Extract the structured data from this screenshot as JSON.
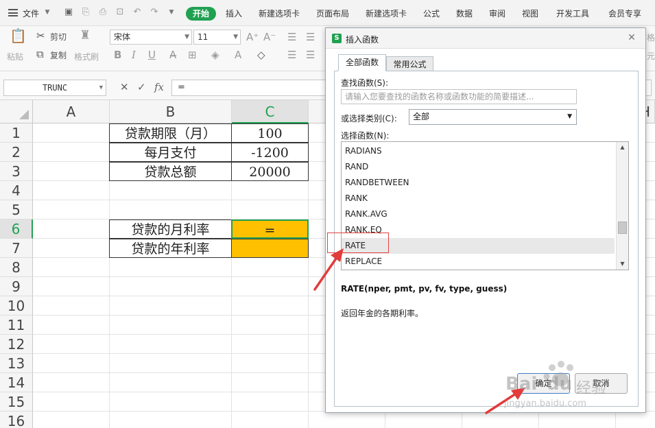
{
  "menu": {
    "file": "文件",
    "tabs": [
      "开始",
      "插入",
      "新建选项卡",
      "页面布局",
      "新建选项卡",
      "公式",
      "数据",
      "审阅",
      "视图",
      "开发工具",
      "会员专享"
    ]
  },
  "ribbon": {
    "paste": "粘贴",
    "cut": "剪切",
    "copy": "复制",
    "format_painter": "格式刷",
    "font_name": "宋体",
    "font_size": "11",
    "bold": "B",
    "italic": "I",
    "underline": "U",
    "right_fragment_1": "格",
    "right_fragment_2": "元"
  },
  "formula_bar": {
    "name_box": "TRUNC",
    "cancel_icon": "✕",
    "confirm_icon": "✓",
    "fx_label": "fx",
    "value": "="
  },
  "sheet": {
    "columns": [
      "A",
      "B",
      "C"
    ],
    "partial_column": "H",
    "rows": [
      "1",
      "2",
      "3",
      "4",
      "5",
      "6",
      "7",
      "8",
      "9",
      "10",
      "11",
      "12",
      "13",
      "14",
      "15",
      "16"
    ],
    "cells": {
      "b1": "贷款期限（月）",
      "c1": "100",
      "b2": "每月支付",
      "c2": "-1200",
      "b3": "贷款总额",
      "c3": "20000",
      "b6": "贷款的月利率",
      "c6": "=",
      "b7": "贷款的年利率",
      "c7": ""
    },
    "active_cell_color": "#ffc000"
  },
  "dialog": {
    "title": "插入函数",
    "tab_all": "全部函数",
    "tab_common": "常用公式",
    "search_label": "查找函数(S):",
    "search_placeholder": "请输入您要查找的函数名称或函数功能的简要描述...",
    "category_label": "或选择类别(C):",
    "category_value": "全部",
    "list_label": "选择函数(N):",
    "functions": [
      "RADIANS",
      "RAND",
      "RANDBETWEEN",
      "RANK",
      "RANK.AVG",
      "RANK.EQ",
      "RATE",
      "REPLACE"
    ],
    "selected_function": "RATE",
    "syntax": "RATE(nper, pmt, pv, fv, type, guess)",
    "description": "返回年金的各期利率。",
    "ok": "确定",
    "cancel": "取消"
  },
  "watermark": {
    "brand": "Bai",
    "brand2": "du",
    "site_cn": "经验",
    "site_url": "jingyan.baidu.com"
  },
  "colors": {
    "accent_green": "#20a152",
    "highlight_red": "#e04040",
    "arrow_red": "#e23b3b"
  }
}
